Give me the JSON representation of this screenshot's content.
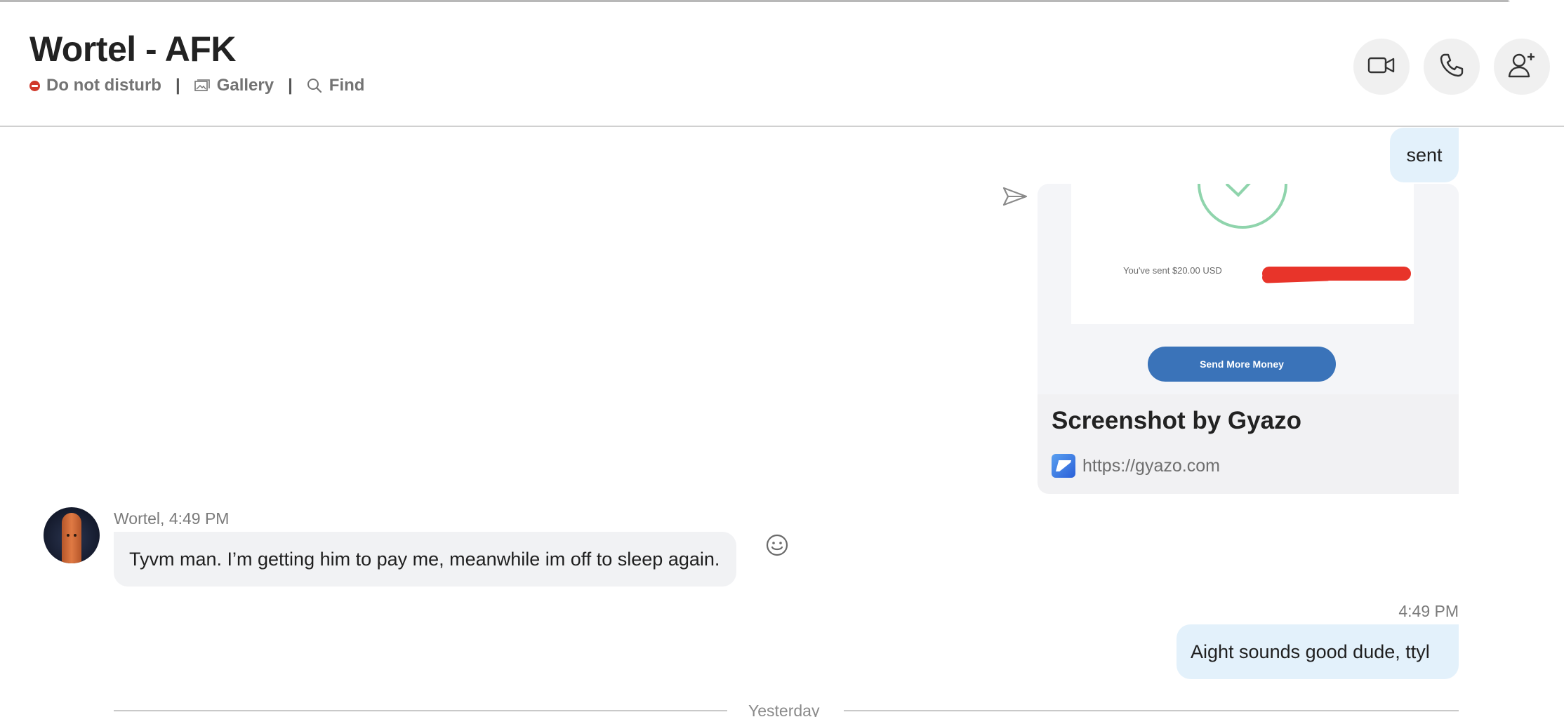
{
  "header": {
    "title": "Wortel - AFK",
    "status_label": "Do not disturb",
    "status_color": "#d0392b",
    "separator": "|",
    "gallery_label": "Gallery",
    "find_label": "Find",
    "icons": [
      "video-camera-icon",
      "phone-icon",
      "add-person-icon"
    ]
  },
  "messages": {
    "sent_bubble": "sent",
    "link_card": {
      "image_text": "You've sent $20.00 USD",
      "image_button": "Send More Money",
      "title": "Screenshot by Gyazo",
      "url": "https://gyazo.com"
    },
    "incoming": {
      "meta": "Wortel, 4:49 PM",
      "text": "Tyvm man. I’m getting him to pay me, meanwhile im off to sleep again."
    },
    "outgoing": {
      "meta": "4:49 PM",
      "text": "Aight sounds good dude, ttyl"
    }
  },
  "divider": {
    "label": "Yesterday"
  },
  "colors": {
    "outgoing_bubble": "#e3f1fb",
    "incoming_bubble": "#f1f2f4",
    "paypal_button": "#3a73b9",
    "redaction": "#e8342a"
  }
}
